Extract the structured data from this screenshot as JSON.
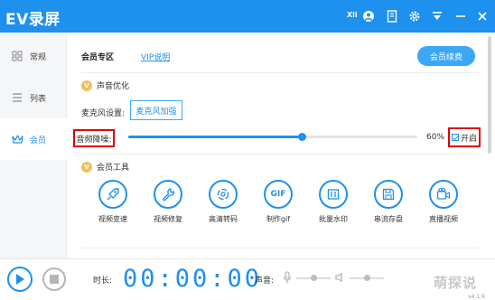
{
  "app": {
    "title": "EV录屏",
    "user": "Xli",
    "version": "v4.1.9"
  },
  "sidebar": {
    "items": [
      {
        "label": "常规",
        "icon": "grid-icon"
      },
      {
        "label": "列表",
        "icon": "list-icon"
      },
      {
        "label": "会员",
        "icon": "crown-icon",
        "active": true
      }
    ]
  },
  "vip": {
    "label": "会员专区",
    "link": "VIP说明",
    "renew_label": "会员续费"
  },
  "audio": {
    "section_title": "声音优化",
    "mic_settings_label": "麦克风设置:",
    "mic_boost_label": "麦克风加强",
    "noise_label": "音频降噪:",
    "noise_percent": 60,
    "noise_value_text": "60%",
    "enable_label": "开启",
    "enabled": true
  },
  "tools": {
    "section_title": "会员工具",
    "items": [
      {
        "label": "视频变速",
        "icon": "rocket-icon"
      },
      {
        "label": "视频修复",
        "icon": "wrench-icon"
      },
      {
        "label": "高清转码",
        "icon": "transcode-icon"
      },
      {
        "label": "制作gif",
        "icon": "gif-icon"
      },
      {
        "label": "批量水印",
        "icon": "watermark-icon"
      },
      {
        "label": "串流存盘",
        "icon": "save-icon"
      },
      {
        "label": "直播视频",
        "icon": "camera-icon"
      }
    ]
  },
  "bottom": {
    "duration_label": "时长:",
    "timer": "00:00:00",
    "volume_label": "声音:",
    "mic_volume": 0.5,
    "speaker_volume": 0.5
  },
  "watermark": "萌探说",
  "colors": {
    "accent": "#1e90ee",
    "highlight_box": "#e00000",
    "vip_badge": "#f0c060"
  }
}
